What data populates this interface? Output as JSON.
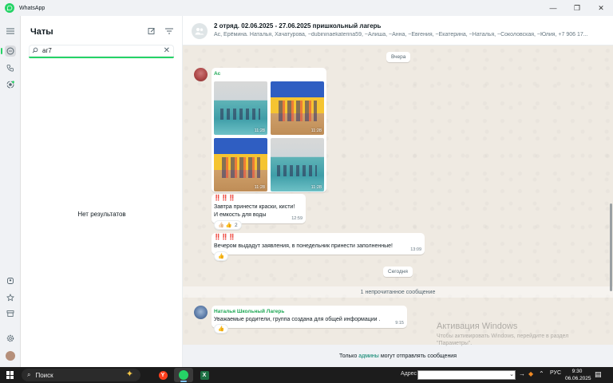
{
  "window": {
    "title": "WhatsApp",
    "controls": [
      "—",
      "❐",
      "✕"
    ]
  },
  "sidebar_rail": {
    "icons": [
      "menu-icon",
      "chats-icon",
      "calls-icon",
      "status-icon",
      "communities-icon",
      "starred-icon",
      "archive-icon",
      "settings-icon",
      "profile-avatar"
    ]
  },
  "chat_list": {
    "title": "Чаты",
    "search_value": "аг7",
    "search_placeholder": "Поиск",
    "no_results": "Нет результатов"
  },
  "conversation": {
    "group_name": "2 отряд. 02.06.2025 - 27.06.2025 пришкольный лагерь",
    "members": "Ас, Ерёмина. Наталья, Хачатурова, ~dubininaekaterina59, ~Алиша, ~Анна, ~Евгения, ~Екатерина, ~Наталья, ~Соколовская, ~Юлия, +7 906 17...",
    "date_yesterday": "Вчера",
    "album": {
      "sender": "Ас",
      "sender_color": "#1fa855",
      "photo_times": [
        "11:28",
        "11:28",
        "11:28",
        "11:28"
      ]
    },
    "messages": [
      {
        "prefix": "‼️‼️‼️",
        "line1": "Завтра принести краски, кисти!",
        "line2": "И емкость для воды",
        "time": "12:59",
        "reaction": "👍🏻 👍",
        "reaction_count": "2"
      },
      {
        "prefix": "‼️‼️‼️",
        "line1": "Вечером выдадут заявления, в понедельник принести заполненные!",
        "time": "13:09",
        "reaction": "👍"
      }
    ],
    "date_today": "Сегодня",
    "unread_banner": "1 непрочитанное сообщение",
    "new_message": {
      "sender": "Наталья Школьный Лагерь",
      "sender_color": "#1fa855",
      "text": "Уважаемые родители, группа создана для общей информации .",
      "time": "9:15",
      "reaction": "👍"
    },
    "footer": {
      "before": "Только",
      "link": "админы",
      "after": "могут отправлять сообщения"
    }
  },
  "watermark": {
    "line1": "Активация Windows",
    "line2": "Чтобы активировать Windows, перейдите в раздел",
    "line3": "\"Параметры\"."
  },
  "taskbar": {
    "search_label": "Поиск",
    "address_label": "Адрес",
    "language": "РУС",
    "time": "9:30",
    "date": "06.06.2025"
  }
}
